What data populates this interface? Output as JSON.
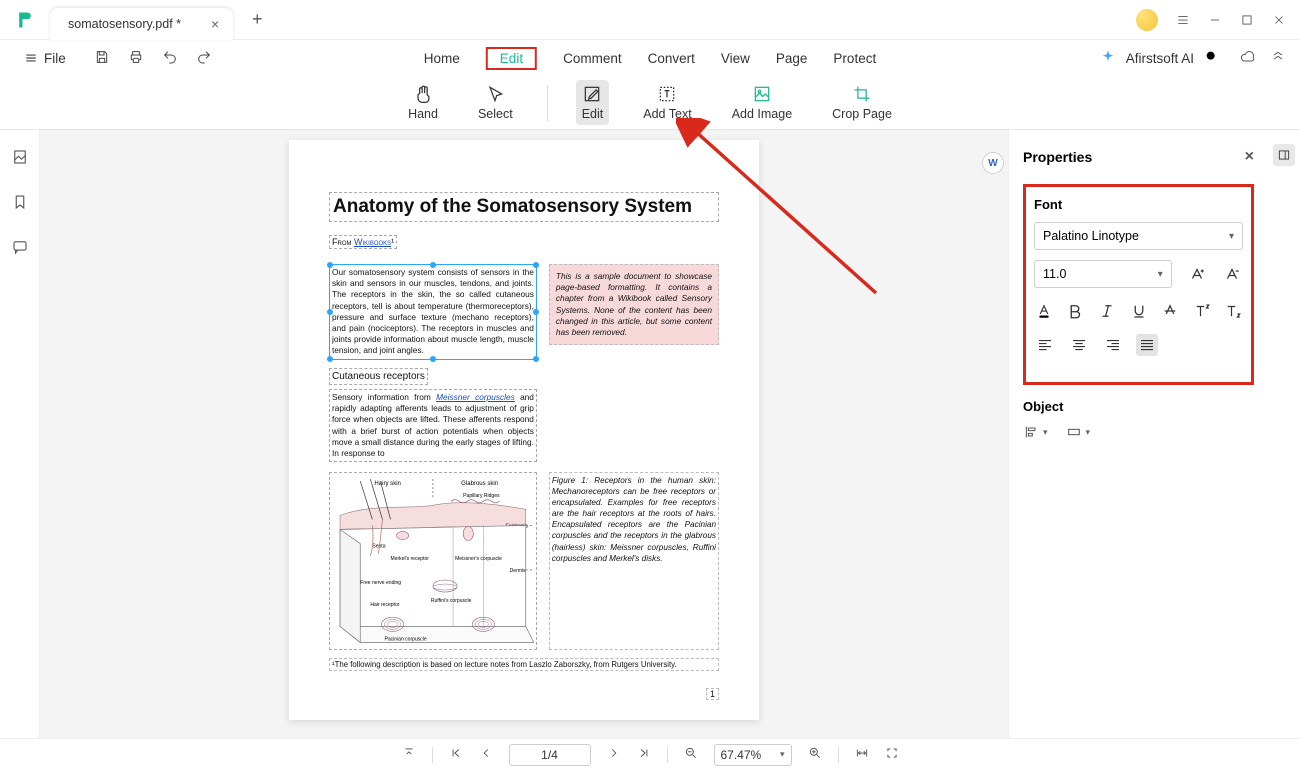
{
  "titlebar": {
    "tab_name": "somatosensory.pdf *"
  },
  "menubar": {
    "file": "File",
    "tabs": {
      "home": "Home",
      "edit": "Edit",
      "comment": "Comment",
      "convert": "Convert",
      "view": "View",
      "page": "Page",
      "protect": "Protect"
    },
    "ai": "Afirstsoft AI"
  },
  "toolbar": {
    "hand": "Hand",
    "select": "Select",
    "edit": "Edit",
    "add_text": "Add Text",
    "add_image": "Add Image",
    "crop_page": "Crop Page"
  },
  "document": {
    "title": "Anatomy of the Somatosensory System",
    "from_prefix": "From ",
    "from_link": "Wikibooks",
    "from_suffix": "¹",
    "para1": "Our somatosensory system consists of sensors in the skin and sensors in our muscles, tendons, and joints. The receptors in the skin, the so called cutaneous receptors, tell is about temperature (thermoreceptors), pressure and surface texture (mechano receptors), and pain (nociceptors). The receptors in muscles and joints provide information about muscle length, muscle tension, and joint angles.",
    "sidebox": "This is a sample document to showcase page-based formatting. It contains a chapter from a Wikibook called Sensory Systems. None of the content has been changed in this article, but some content has been removed.",
    "subhead": "Cutaneous receptors",
    "para2_a": "Sensory information from ",
    "para2_link": "Meissner corpuscles",
    "para2_b": " and rapidly adapting afferents leads to adjustment of grip force when objects are lifted. These afferents respond with a brief burst of action potentials when objects move a small distance during the early stages of lifting. In response to",
    "fig_caption": "Figure 1: Receptors in the human skin: Mechanoreceptors can be free receptors or encapsulated. Examples for free receptors are the hair receptors at the roots of hairs. Encapsulated receptors are the Pacinian corpuscles and the receptors in the glabrous (hairless) skin: Meissner corpuscles, Ruffini corpuscles and Merkel's disks.",
    "fig_labels": {
      "hairy": "Hairy skin",
      "glab": "Glabrous skin",
      "epid": "Epidermis",
      "derm": "Dermis",
      "sept": "Septa",
      "pap": "Papillary Ridges",
      "merk": "Merkel's receptor",
      "meis": "Meissner's corpuscle",
      "fne": "Free nerve ending",
      "ruf": "Ruffini's corpuscle",
      "pac": "Pacinian corpuscle",
      "hr": "Hair receptor"
    },
    "footnote": "¹The following description is based on lecture notes from Laszlo Zaborszky, from Rutgers University.",
    "page_number": "1"
  },
  "properties": {
    "header": "Properties",
    "font_label": "Font",
    "font_family": "Palatino Linotype",
    "font_size": "11.0",
    "object_label": "Object"
  },
  "status": {
    "page": "1/4",
    "zoom": "67.47%"
  }
}
